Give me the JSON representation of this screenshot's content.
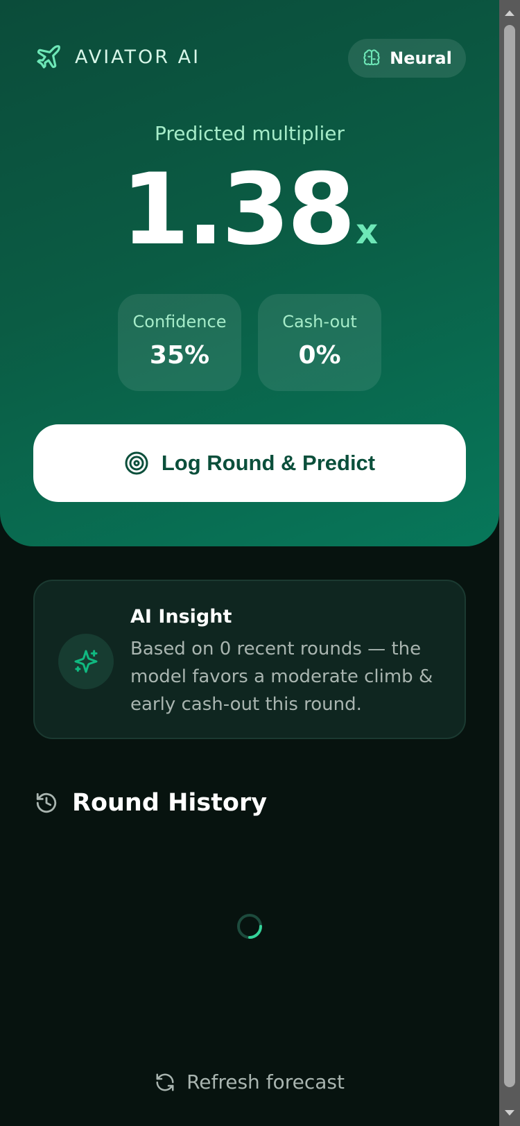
{
  "brand": {
    "name": "AVIATOR AI",
    "icon": "plane-icon"
  },
  "mode_badge": {
    "label": "Neural",
    "icon": "brain-icon"
  },
  "prediction": {
    "label": "Predicted multiplier",
    "value": "1.38",
    "suffix": "x"
  },
  "stats": {
    "confidence": {
      "label": "Confidence",
      "value": "35%"
    },
    "cashout": {
      "label": "Cash-out",
      "value": "0%"
    }
  },
  "cta": {
    "label": "Log Round & Predict",
    "icon": "target-icon"
  },
  "insight": {
    "title": "AI Insight",
    "body": "Based on 0 recent rounds — the model favors a moderate climb & early cash-out this round.",
    "icon": "sparkle-icon"
  },
  "history": {
    "title": "Round History",
    "icon": "history-icon"
  },
  "refresh": {
    "label": "Refresh forecast",
    "icon": "refresh-icon"
  },
  "colors": {
    "accent": "#6ee7b7",
    "hero_start": "#0b4c3a",
    "hero_end": "#07775a",
    "background": "#07130f",
    "cta_text": "#0b4f3b"
  }
}
